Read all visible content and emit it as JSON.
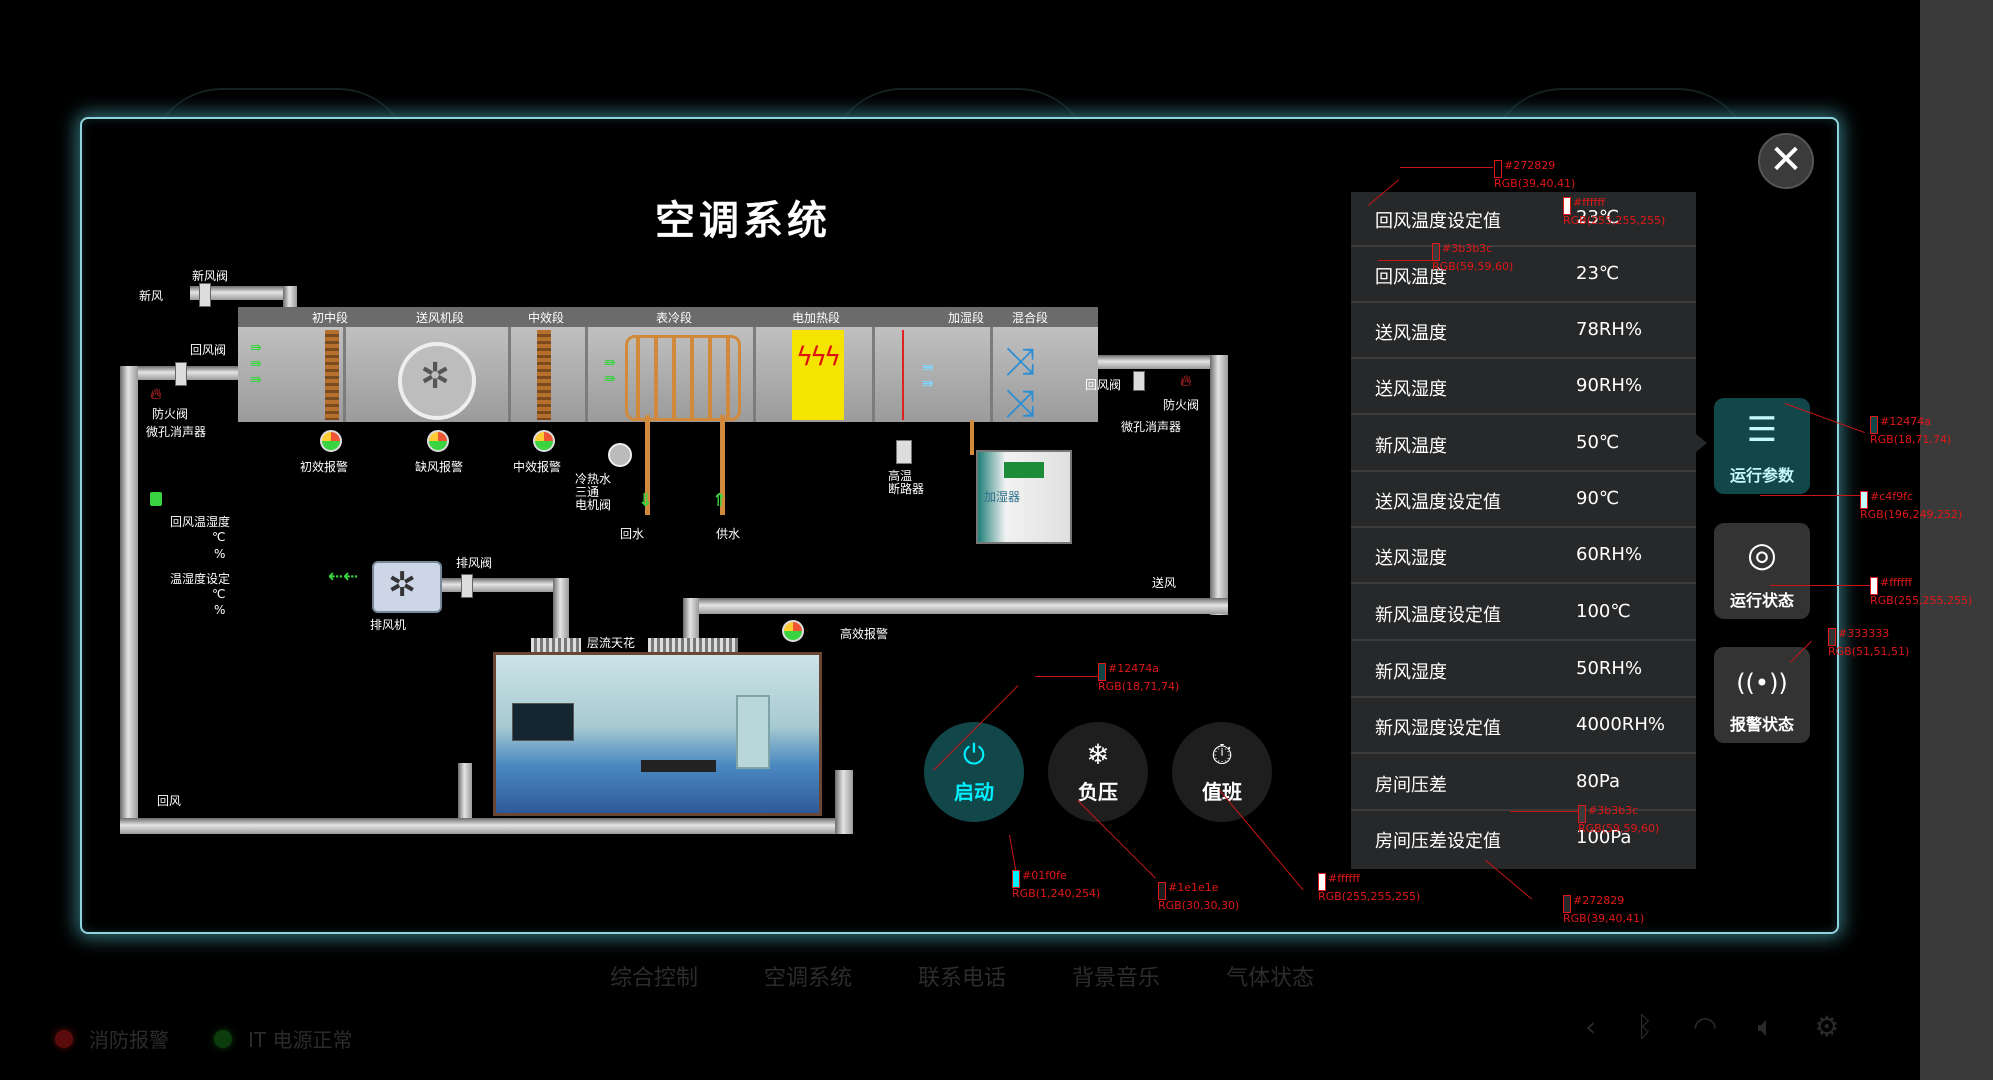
{
  "background_app": {
    "nav": [
      "综合控制",
      "空调系统",
      "联系电话",
      "背景音乐",
      "气体状态"
    ],
    "status": [
      {
        "label": "消防报警",
        "color": "#5a0b0b"
      },
      {
        "label": "IT 电源正常",
        "color": "#0c3b0c"
      }
    ]
  },
  "modal": {
    "title": "空调系统",
    "close_icon": "close-icon"
  },
  "diagram": {
    "sections": [
      "初中段",
      "送风机段",
      "中效段",
      "表冷段",
      "电加热段",
      "加湿段",
      "混合段"
    ],
    "labels": {
      "fresh_air_valve": "新风阀",
      "fresh_air": "新风",
      "return_valve_left": "回风阀",
      "fire_valve_left": "防火阀",
      "silencer_left": "微孔消声器",
      "alarm_primary": "初效报警",
      "alarm_wind": "缺风报警",
      "alarm_medium": "中效报警",
      "chill_valve": "冷热水\n三通\n电机阀",
      "return_water": "回水",
      "supply_water": "供水",
      "hightemp": "高温\n断路器",
      "humidifier": "加湿器",
      "return_valve_right": "回风阀",
      "fire_valve_right": "防火阀",
      "silencer_right": "微孔消声器",
      "return_temp_hum": "回风温湿度",
      "deg_c": "℃",
      "percent": "%",
      "temp_hum_set": "温湿度设定",
      "exhaust_valve": "排风阀",
      "exhaust_fan": "排风机",
      "supply_air": "送风",
      "laminar": "层流天花",
      "hepa_alarm": "高效报警",
      "return_air": "回风"
    }
  },
  "controls": [
    {
      "label": "启动",
      "icon": "power-icon",
      "glyph": "⏻"
    },
    {
      "label": "负压",
      "icon": "snowflake-icon",
      "glyph": "❄"
    },
    {
      "label": "值班",
      "icon": "person-clock-icon",
      "glyph": "⏱"
    }
  ],
  "params": [
    {
      "name": "回风温度设定值",
      "value": "23℃"
    },
    {
      "name": "回风温度",
      "value": "23℃"
    },
    {
      "name": "送风温度",
      "value": "78RH%"
    },
    {
      "name": "送风湿度",
      "value": "90RH%"
    },
    {
      "name": "新风温度",
      "value": "50℃"
    },
    {
      "name": "送风温度设定值",
      "value": "90℃"
    },
    {
      "name": "送风湿度",
      "value": "60RH%"
    },
    {
      "name": "新风温度设定值",
      "value": "100℃"
    },
    {
      "name": "新风湿度",
      "value": "50RH%"
    },
    {
      "name": "新风湿度设定值",
      "value": "4000RH%"
    },
    {
      "name": "房间压差",
      "value": "80Pa"
    },
    {
      "name": "房间压差设定值",
      "value": "100Pa"
    }
  ],
  "tabs": [
    {
      "label": "运行参数",
      "icon": "list-icon",
      "glyph": "☰"
    },
    {
      "label": "运行状态",
      "icon": "status-ring-icon",
      "glyph": "◎"
    },
    {
      "label": "报警状态",
      "icon": "alarm-broadcast-icon",
      "glyph": "((•))"
    }
  ],
  "annotations": [
    {
      "hex": "#272829",
      "rgb": "RGB(39,40,41)"
    },
    {
      "hex": "#ffffff",
      "rgb": "RGB(255,255,255)"
    },
    {
      "hex": "#3b3b3c",
      "rgb": "RGB(59,59,60)"
    },
    {
      "hex": "#12474a",
      "rgb": "RGB(18,71,74)"
    },
    {
      "hex": "#c4f9fc",
      "rgb": "RGB(196,249,252)"
    },
    {
      "hex": "#ffffff",
      "rgb": "RGB(255,255,255)"
    },
    {
      "hex": "#333333",
      "rgb": "RGB(51,51,51)"
    },
    {
      "hex": "#12474a",
      "rgb": "RGB(18,71,74)"
    },
    {
      "hex": "#01f0fe",
      "rgb": "RGB(1,240,254)"
    },
    {
      "hex": "#1e1e1e",
      "rgb": "RGB(30,30,30)"
    },
    {
      "hex": "#ffffff",
      "rgb": "RGB(255,255,255)"
    },
    {
      "hex": "#3b3b3c",
      "rgb": "RGB(59,59,60)"
    },
    {
      "hex": "#272829",
      "rgb": "RGB(39,40,41)"
    }
  ],
  "colors": {
    "accent": "#01f0fe",
    "active_bg": "#12474a",
    "panel_bg": "#272829",
    "divider": "#3b3b3c",
    "tab_bg": "#333333",
    "button_bg": "#1e1e1e",
    "tab_active_text": "#c4f9fc",
    "modal_border": "#8fd3dd"
  }
}
